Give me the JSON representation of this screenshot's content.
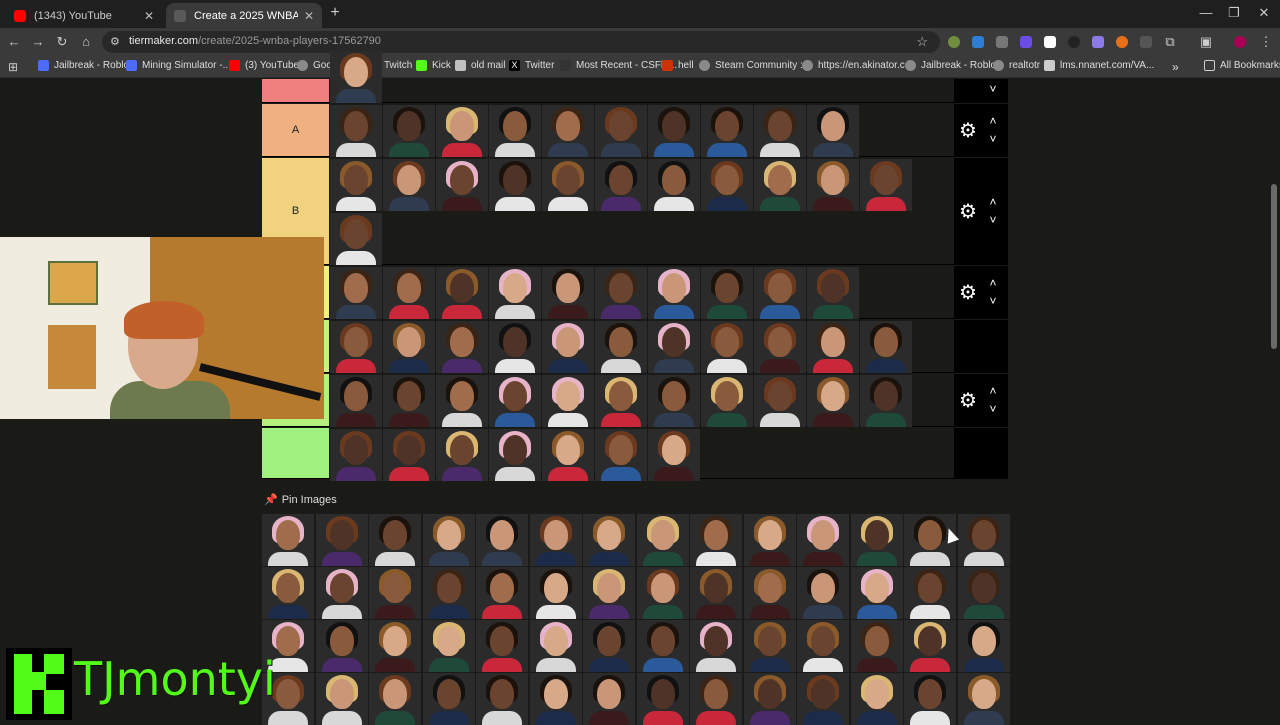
{
  "browser": {
    "tabs": [
      {
        "title": "(1343) YouTube",
        "active": false,
        "favicon_color": "#ff0000"
      },
      {
        "title": "Create a 2025 WNBA Players Ti",
        "active": true,
        "favicon_color": "#3c3c3c"
      }
    ],
    "url_host": "tiermaker.com",
    "url_path": "/create/2025-wnba-players-17562790",
    "bookmarks": [
      {
        "label": "Jailbreak - Roblox",
        "color": "#4a6cf7"
      },
      {
        "label": "Mining Simulator -...",
        "color": "#4a6cf7"
      },
      {
        "label": "(3) YouTube",
        "color": "#ff0000"
      },
      {
        "label": "Google Docs",
        "color": "#8a8a8a"
      },
      {
        "label": "Twitch",
        "color": "#9146ff"
      },
      {
        "label": "Kick",
        "color": "#53fc18"
      },
      {
        "label": "old mail",
        "color": "#c0c0c0"
      },
      {
        "label": "Twitter",
        "color": "#000000"
      },
      {
        "label": "Most Recent - CSFlo...",
        "color": "#333333"
      },
      {
        "label": "hell",
        "color": "#cc3300"
      },
      {
        "label": "Steam Community :...",
        "color": "#8a8a8a"
      },
      {
        "label": "https://en.akinator.c...",
        "color": "#8a8a8a"
      },
      {
        "label": "Jailbreak - Roblox",
        "color": "#8a8a8a"
      },
      {
        "label": "realtotr",
        "color": "#8a8a8a"
      },
      {
        "label": "lms.nnanet.com/VA...",
        "color": "#cccccc"
      }
    ],
    "all_bookmarks": "All Bookmarks"
  },
  "tiers": [
    {
      "label": "",
      "color": "#f07f7f"
    },
    {
      "label": "A",
      "color": "#f0b07f"
    },
    {
      "label": "B",
      "color": "#f0d27f"
    },
    {
      "label": "",
      "color": "#f0f07f"
    },
    {
      "label": "",
      "color": "#c8f07f"
    },
    {
      "label": "",
      "color": "#b5f07f"
    },
    {
      "label": "",
      "color": "#a0f07f"
    }
  ],
  "pin": {
    "label": "Pin Images"
  },
  "streamer": {
    "name": "TJmontyi",
    "brand_color": "#53fc18"
  },
  "icons": {
    "gear": "gear-icon",
    "up": "chevron-up-icon",
    "down": "chevron-down-icon"
  }
}
